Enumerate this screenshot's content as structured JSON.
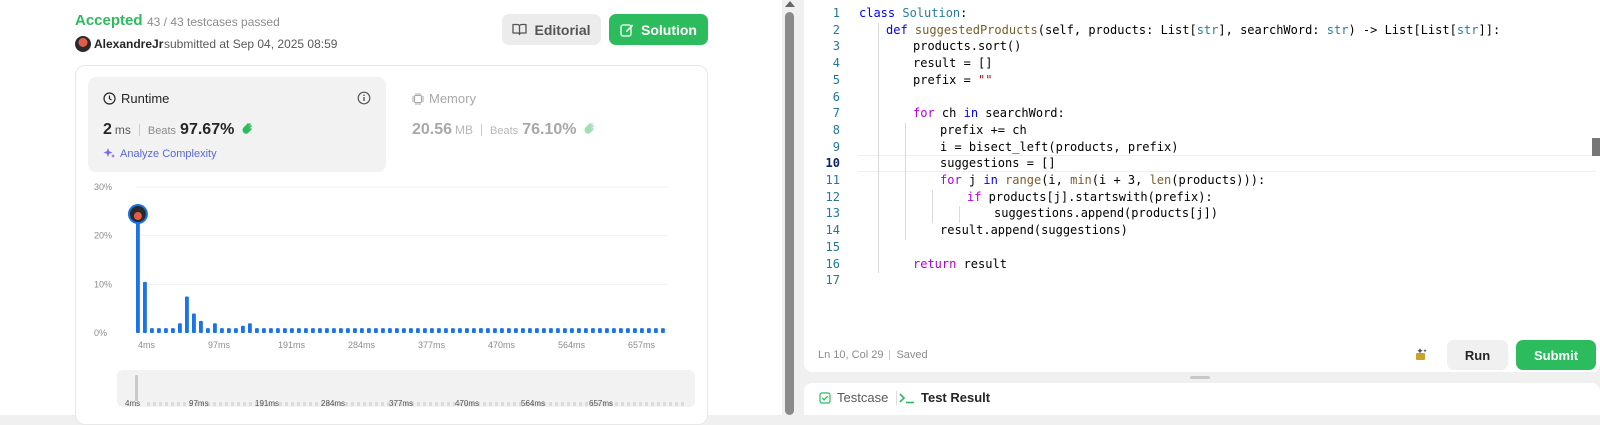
{
  "submission": {
    "status": "Accepted",
    "passed": "43 / 43 testcases passed",
    "user": "AlexandreJr",
    "submitted": "submitted at Sep 04, 2025 08:59",
    "editorial_label": "Editorial",
    "solution_label": "Solution"
  },
  "runtime": {
    "title": "Runtime",
    "value": "2",
    "unit": "ms",
    "beats_label": "Beats",
    "beats": "97.67%",
    "analyze_label": "Analyze Complexity"
  },
  "memory": {
    "title": "Memory",
    "value": "20.56",
    "unit": "MB",
    "beats_label": "Beats",
    "beats": "76.10%"
  },
  "chart_data": {
    "type": "bar",
    "title": "",
    "xlabel": "",
    "ylabel": "",
    "ylim": [
      0,
      30
    ],
    "y_ticks": [
      "0%",
      "10%",
      "20%",
      "30%"
    ],
    "x_ticks": [
      "4ms",
      "97ms",
      "191ms",
      "284ms",
      "377ms",
      "470ms",
      "564ms",
      "657ms"
    ],
    "values": [
      26.5,
      10.5,
      1,
      1,
      1,
      1,
      2,
      7.5,
      4,
      2.5,
      1,
      2,
      1,
      1,
      1,
      1.5,
      2,
      1,
      1,
      1,
      1,
      1,
      1,
      1,
      1,
      1,
      1,
      1,
      1,
      1,
      1,
      1,
      1,
      1,
      1,
      1,
      1,
      1,
      1,
      1,
      1,
      1,
      1,
      1,
      1,
      1,
      1,
      1,
      1,
      1,
      1,
      1,
      1,
      1,
      1,
      1,
      1,
      1,
      1,
      1,
      1,
      1,
      1,
      1,
      1,
      1,
      1,
      1,
      1,
      1,
      1,
      1,
      1,
      1,
      1,
      1
    ],
    "highlight_index": 0,
    "bar_color": "#1a73e8",
    "grid": true
  },
  "editor": {
    "lines": [
      {
        "n": "1",
        "indent": 0,
        "html": "<span class='kw'>class</span> <span class='ty'>Solution</span>:"
      },
      {
        "n": "2",
        "indent": 1,
        "html": "<span class='kw'>def</span> <span class='fn'>suggestedProducts</span>(self, products: List[<span class='ty'>str</span>], searchWord: <span class='ty'>str</span>) -> List[List[<span class='ty'>str</span>]]:"
      },
      {
        "n": "3",
        "indent": 2,
        "html": "products.sort()"
      },
      {
        "n": "4",
        "indent": 2,
        "html": "result = []"
      },
      {
        "n": "5",
        "indent": 2,
        "html": "prefix = <span class='st'>\"\"</span>"
      },
      {
        "n": "6",
        "indent": 0,
        "html": ""
      },
      {
        "n": "7",
        "indent": 2,
        "html": "<span class='kw2'>for</span> ch <span class='kw'>in</span> searchWord:"
      },
      {
        "n": "8",
        "indent": 3,
        "html": "prefix += ch"
      },
      {
        "n": "9",
        "indent": 3,
        "html": "i = bisect_left(products, prefix)"
      },
      {
        "n": "10",
        "indent": 3,
        "html": "suggestions = []"
      },
      {
        "n": "11",
        "indent": 3,
        "html": "<span class='kw2'>for</span> j <span class='kw'>in</span> <span class='fn'>range</span>(i, <span class='fn'>min</span>(i + 3, <span class='fn'>len</span>(products))):"
      },
      {
        "n": "12",
        "indent": 4,
        "html": "<span class='kw2'>if</span> products[j].startswith(prefix):"
      },
      {
        "n": "13",
        "indent": 5,
        "html": "suggestions.append(products[j])"
      },
      {
        "n": "14",
        "indent": 3,
        "html": "result.append(suggestions)"
      },
      {
        "n": "15",
        "indent": 0,
        "html": ""
      },
      {
        "n": "16",
        "indent": 2,
        "html": "<span class='kw2'>return</span> result"
      },
      {
        "n": "17",
        "indent": 0,
        "html": ""
      }
    ],
    "current_line": "10",
    "status_pos": "Ln 10, Col 29",
    "status_saved": "Saved",
    "run_label": "Run",
    "submit_label": "Submit"
  },
  "bottom_tabs": {
    "testcase": "Testcase",
    "test_result": "Test Result"
  },
  "colors": {
    "accent": "#2cbb5d",
    "bar": "#1a73e8",
    "link": "#5a67d8"
  }
}
